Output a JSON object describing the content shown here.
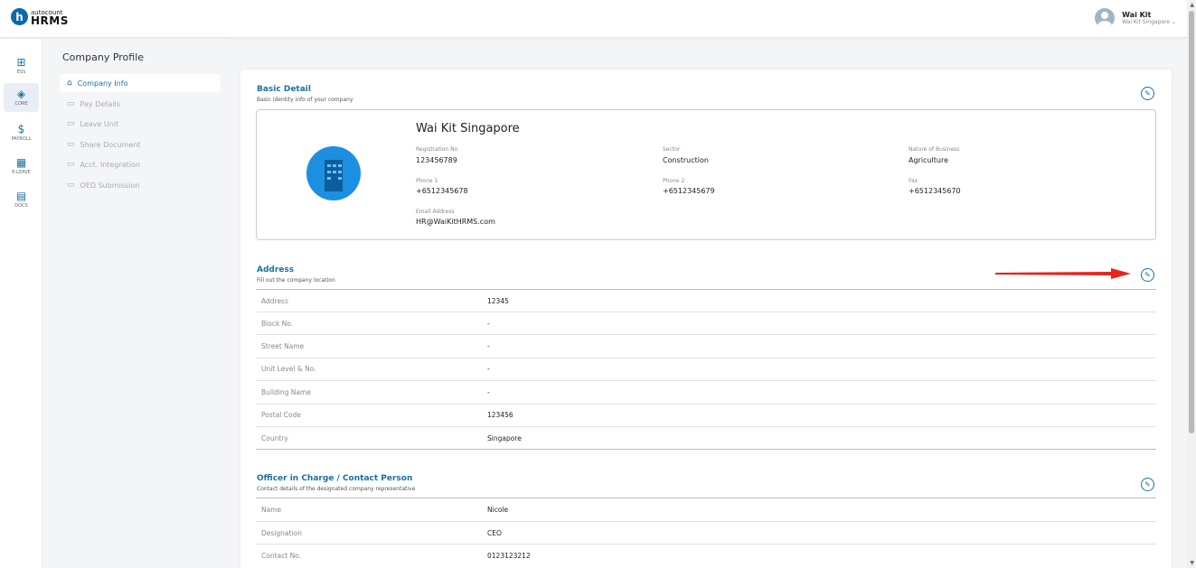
{
  "header": {
    "logo_letter": "h",
    "logo_small": "autocount",
    "logo_big": "HRMS",
    "user_name": "Wai Kit",
    "user_company": "Wai Kit Singapore ⌄"
  },
  "rail": [
    {
      "label": "ESS",
      "icon": "ess-icon",
      "glyph": "⊞"
    },
    {
      "label": "CORE",
      "icon": "core-icon",
      "glyph": "◈"
    },
    {
      "label": "PAYROLL",
      "icon": "payroll-icon",
      "glyph": "$"
    },
    {
      "label": "E-LEAVE",
      "icon": "calendar-icon",
      "glyph": "▦"
    },
    {
      "label": "DOCS",
      "icon": "docs-icon",
      "glyph": "▤"
    }
  ],
  "subnav": {
    "title": "Company Profile",
    "items": [
      {
        "label": "Company Info",
        "glyph": "⌂"
      },
      {
        "label": "Pay Details",
        "glyph": "▭"
      },
      {
        "label": "Leave Unit",
        "glyph": "▭"
      },
      {
        "label": "Share Document",
        "glyph": "▭"
      },
      {
        "label": "Acct. Integration",
        "glyph": "▭"
      },
      {
        "label": "OED Submission",
        "glyph": "▭"
      }
    ]
  },
  "basic": {
    "title": "Basic Detail",
    "subtitle": "Basic identity info of your company",
    "company_name": "Wai Kit Singapore",
    "fields": [
      {
        "label": "Registration No",
        "value": "123456789"
      },
      {
        "label": "Sector",
        "value": "Construction"
      },
      {
        "label": "Nature of Business",
        "value": "Agriculture"
      },
      {
        "label": "Phone 1",
        "value": "+6512345678"
      },
      {
        "label": "Phone 2",
        "value": "+6512345679"
      },
      {
        "label": "Fax",
        "value": "+6512345670"
      },
      {
        "label": "Email Address",
        "value": "HR@WaiKitHRMS.com"
      }
    ]
  },
  "address": {
    "title": "Address",
    "subtitle": "Fill out the company location",
    "rows": [
      {
        "label": "Address",
        "value": "12345"
      },
      {
        "label": "Block No.",
        "value": "-"
      },
      {
        "label": "Street Name",
        "value": "-"
      },
      {
        "label": "Unit Level & No.",
        "value": "-"
      },
      {
        "label": "Building Name",
        "value": "-"
      },
      {
        "label": "Postal Code",
        "value": "123456"
      },
      {
        "label": "Country",
        "value": "Singapore"
      }
    ]
  },
  "officer": {
    "title": "Officer in Charge / Contact Person",
    "subtitle": "Contact details of the designated company representative",
    "rows": [
      {
        "label": "Name",
        "value": "Nicole"
      },
      {
        "label": "Designation",
        "value": "CEO"
      },
      {
        "label": "Contact No.",
        "value": "0123123212"
      }
    ]
  },
  "colors": {
    "accent": "#1d6fa5",
    "arrow": "#e8231b"
  }
}
